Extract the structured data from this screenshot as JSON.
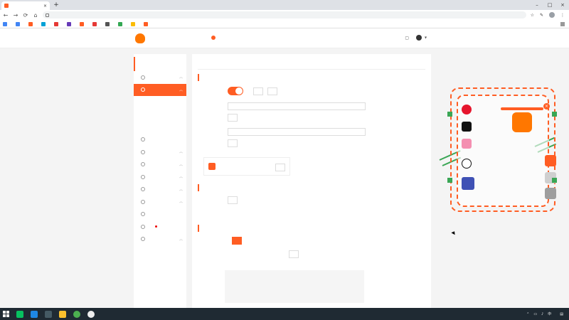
{
  "browser": {
    "tab_title": "",
    "tab_close": "×",
    "new_tab": "+",
    "window_controls": [
      "–",
      "□",
      "×"
    ],
    "nav": {
      "back": "←",
      "forward": "→",
      "reload": "⟳",
      "home": "⌂"
    },
    "url": "",
    "address_icons": [
      "☆",
      "✎",
      "⋮"
    ],
    "bookmarks": [],
    "bookmarks_more": ""
  },
  "site": {
    "logo_text": "",
    "nav": [],
    "download": "",
    "username": ""
  },
  "sidebar": {
    "title": "",
    "items": []
  },
  "content": {
    "page_title": "",
    "sec_stream": "",
    "toggle_label": "",
    "toggle_on": true,
    "stream_tabs": [],
    "rtmp_label": "",
    "rtmp_value": "",
    "copy_label": "",
    "code_label": "",
    "code_value": "",
    "promo": {
      "title": "",
      "subtitle": "",
      "badge": "",
      "button": ""
    },
    "sec_preview": "",
    "preview_label": "",
    "preview_button": "",
    "preview_note": "",
    "preview_link": "",
    "sec_room": "",
    "room_id_label": "",
    "room_id_value": "",
    "room_id_button": "",
    "room_name_label": "",
    "room_name_value": "",
    "room_name_button": "",
    "room_name_note": "",
    "notice_label": "",
    "notice_text": ""
  },
  "overlay": {
    "rows": [],
    "big": [],
    "card": {
      "header": "",
      "sub": "",
      "brand": "",
      "download": ""
    },
    "close": "×"
  },
  "taskbar": {
    "time": "",
    "date": ""
  },
  "colors": {
    "accent": "#ff5d23",
    "overlay_text": "#ff8a1d",
    "handle": "#3aa655",
    "taskbar": "#1f2a33"
  }
}
